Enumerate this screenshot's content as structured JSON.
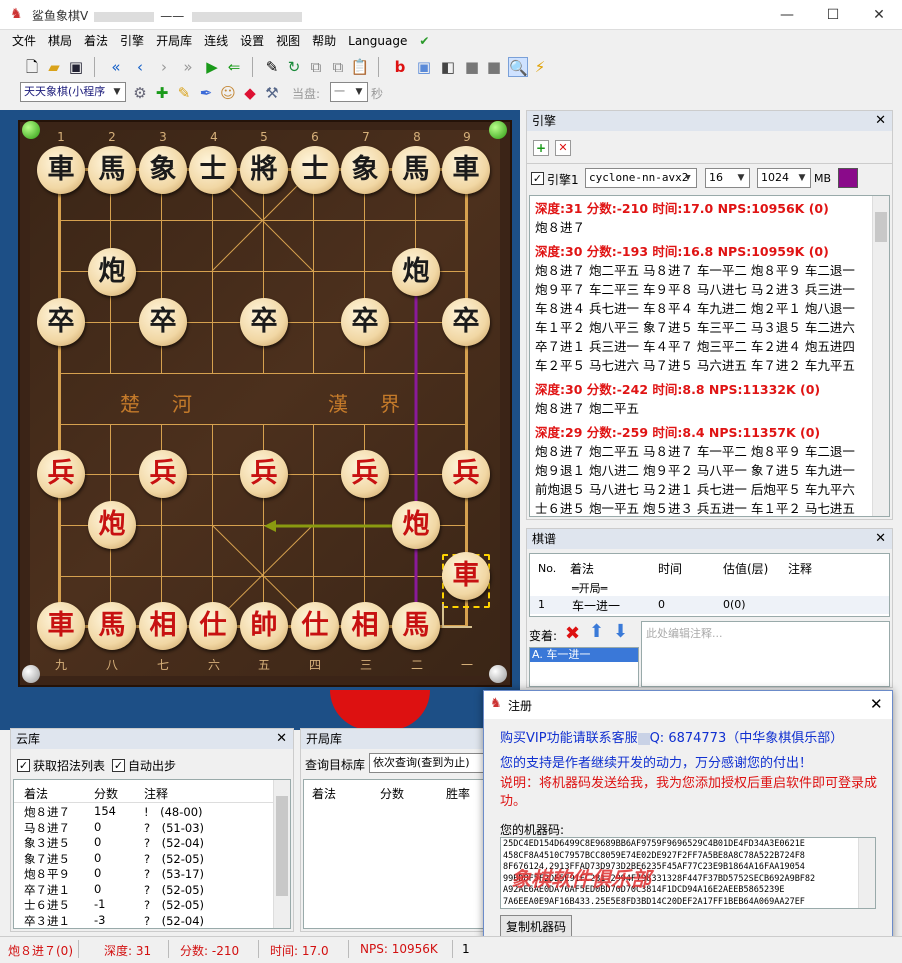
{
  "window": {
    "title": "鲨鱼象棋V",
    "title_sep": "——"
  },
  "menu": [
    "文件",
    "棋局",
    "着法",
    "引擎",
    "开局库",
    "连线",
    "设置",
    "视图",
    "帮助",
    "Language"
  ],
  "toolbar2": {
    "opponent": "天天象棋(小程序",
    "dangpan_label": "当盘:",
    "dangpan_value": "一",
    "seconds_label": "秒"
  },
  "board": {
    "top_files": [
      "1",
      "2",
      "3",
      "4",
      "5",
      "6",
      "7",
      "8",
      "9"
    ],
    "bottom_files": [
      "九",
      "八",
      "七",
      "六",
      "五",
      "四",
      "三",
      "二",
      "一"
    ],
    "river_left": "楚　河",
    "river_right": "漢　界",
    "black_back": [
      "車",
      "馬",
      "象",
      "士",
      "將",
      "士",
      "象",
      "馬",
      "車"
    ],
    "black_cannons": [
      "炮",
      "炮"
    ],
    "black_soldiers": [
      "卒",
      "卒",
      "卒",
      "卒",
      "卒"
    ],
    "red_soldiers": [
      "兵",
      "兵",
      "兵",
      "兵",
      "兵"
    ],
    "red_cannons": [
      "炮",
      "炮"
    ],
    "red_back": [
      "車",
      "馬",
      "相",
      "仕",
      "帥",
      "仕",
      "相",
      "馬"
    ],
    "red_moved_chariot": "車"
  },
  "engine_panel": {
    "title": "引擎",
    "engine_label": "引擎1",
    "engine_name": "cyclone-nn-avx2",
    "threads": "16",
    "hash": "1024",
    "hash_unit": "MB",
    "lines": [
      {
        "head": "深度:31  分数:-210  时间:17.0  NPS:10956K  (0)",
        "body": [
          "炮８进７"
        ]
      },
      {
        "head": "深度:30  分数:-193  时间:16.8  NPS:10959K  (0)",
        "body": [
          "炮８进７ 炮二平五 马８进７ 车一平二 炮８平９ 车二退一",
          "炮９平７ 车二平三 车９平８ 马八进七 马２进３ 兵三进一",
          "车８进４ 兵七进一 车８平４ 车九进二 炮２平１ 炮八退一",
          "车１平２ 炮八平三 象７进５ 车三平二 马３退５ 车二进六",
          "卒７进１ 兵三进一 车４平７ 炮三平二 车２进４ 炮五进四",
          "车２平５ 马七进六 马７进５ 马六进五 车７进２ 车九平五"
        ]
      },
      {
        "head": "深度:30  分数:-242  时间:8.8  NPS:11332K  (0)",
        "body": [
          "炮８进７ 炮二平五"
        ]
      },
      {
        "head": "深度:29  分数:-259  时间:8.4  NPS:11357K  (0)",
        "body": [
          "炮８进７ 炮二平五 马８进７ 车一平二 炮８平９ 车二退一",
          "炮９退１ 炮八进二 炮９平２ 马八平一 象７进５ 车九进一",
          "前炮退５ 马八进七 马２进１ 兵七进一 后炮平５ 车九平六",
          "士６进５ 炮一平五 炮５进３ 兵五进一 车１平２ 马七进五"
        ]
      }
    ]
  },
  "record_panel": {
    "title": "棋谱",
    "columns": [
      "No.",
      "着法",
      "时间",
      "估值(层)",
      "注释"
    ],
    "start_row": "═开局═",
    "rows": [
      {
        "no": "1",
        "move": "车一进一",
        "time": "0",
        "eval": "0(0)",
        "note": ""
      }
    ],
    "variation_label": "变着:",
    "variation_item": "A. 车一进一",
    "comment_placeholder": "此处编辑注释..."
  },
  "cloud_panel": {
    "title": "云库",
    "chk_fetch": "获取招法列表",
    "chk_auto": "自动出步",
    "columns": [
      "着法",
      "分数",
      "注释"
    ],
    "rows": [
      {
        "move": "炮８进７",
        "score": "154",
        "note": "!　(48-00)"
      },
      {
        "move": "马８进７",
        "score": "0",
        "note": "?　(51-03)"
      },
      {
        "move": "象３进５",
        "score": "0",
        "note": "?　(52-04)"
      },
      {
        "move": "象７进５",
        "score": "0",
        "note": "?　(52-05)"
      },
      {
        "move": "炮８平９",
        "score": "0",
        "note": "?　(53-17)"
      },
      {
        "move": "卒７进１",
        "score": "0",
        "note": "?　(52-05)"
      },
      {
        "move": "士６进５",
        "score": "-1",
        "note": "?　(52-05)"
      },
      {
        "move": "卒３进１",
        "score": "-3",
        "note": "?　(52-04)"
      }
    ]
  },
  "opening_panel": {
    "title": "开局库",
    "query_label": "查询目标库",
    "query_mode": "依次查询(查到为止)",
    "columns": [
      "着法",
      "分数",
      "胜率"
    ]
  },
  "register_dialog": {
    "title": "注册",
    "line1": "购买VIP功能请联系客服",
    "line1_tail": "Q: 6874773（中华象棋俱乐部）",
    "line2": "您的支持是作者继续开发的动力，万分感谢您的付出！",
    "line3": "说明：将机器码发送给我，我为您添加授权后重启软件即可登录成功。",
    "code_label": "您的机器码:",
    "code_lines": [
      "25DC4ED154D6499C8E9689BB6AF9759F9696529C4B01DE4FD34A3E0621E",
      "458CF8A4510C7957BCC8059E74E02DE927F2FF7A5BE8A8C78A522B724F8",
      "8F676124.2913FFAD73D973D2BE6235F45AF77C23E9B1864A16FAA19054",
      "99BD8F5F2DE5E91FC281-2994F798331328F447F37BD5752SECB692A9BF82",
      "A92AE6AE0DA76AF5ED0BD70D70C3814F1DCD94A16E2AEEB5865239E",
      "7A6EEA0E9AF16B433.25E5E8FD3BD14C20DEF2A17FF1BEB64A069AA27EF"
    ],
    "watermark": "象棋软件俱乐部",
    "copy_button": "复制机器码"
  },
  "status": {
    "move": "炮８进７(0)",
    "depth": "深度: 31",
    "score": "分数: -210",
    "time": "时间: 17.0",
    "nps": "NPS: 10956K",
    "page": "1"
  }
}
